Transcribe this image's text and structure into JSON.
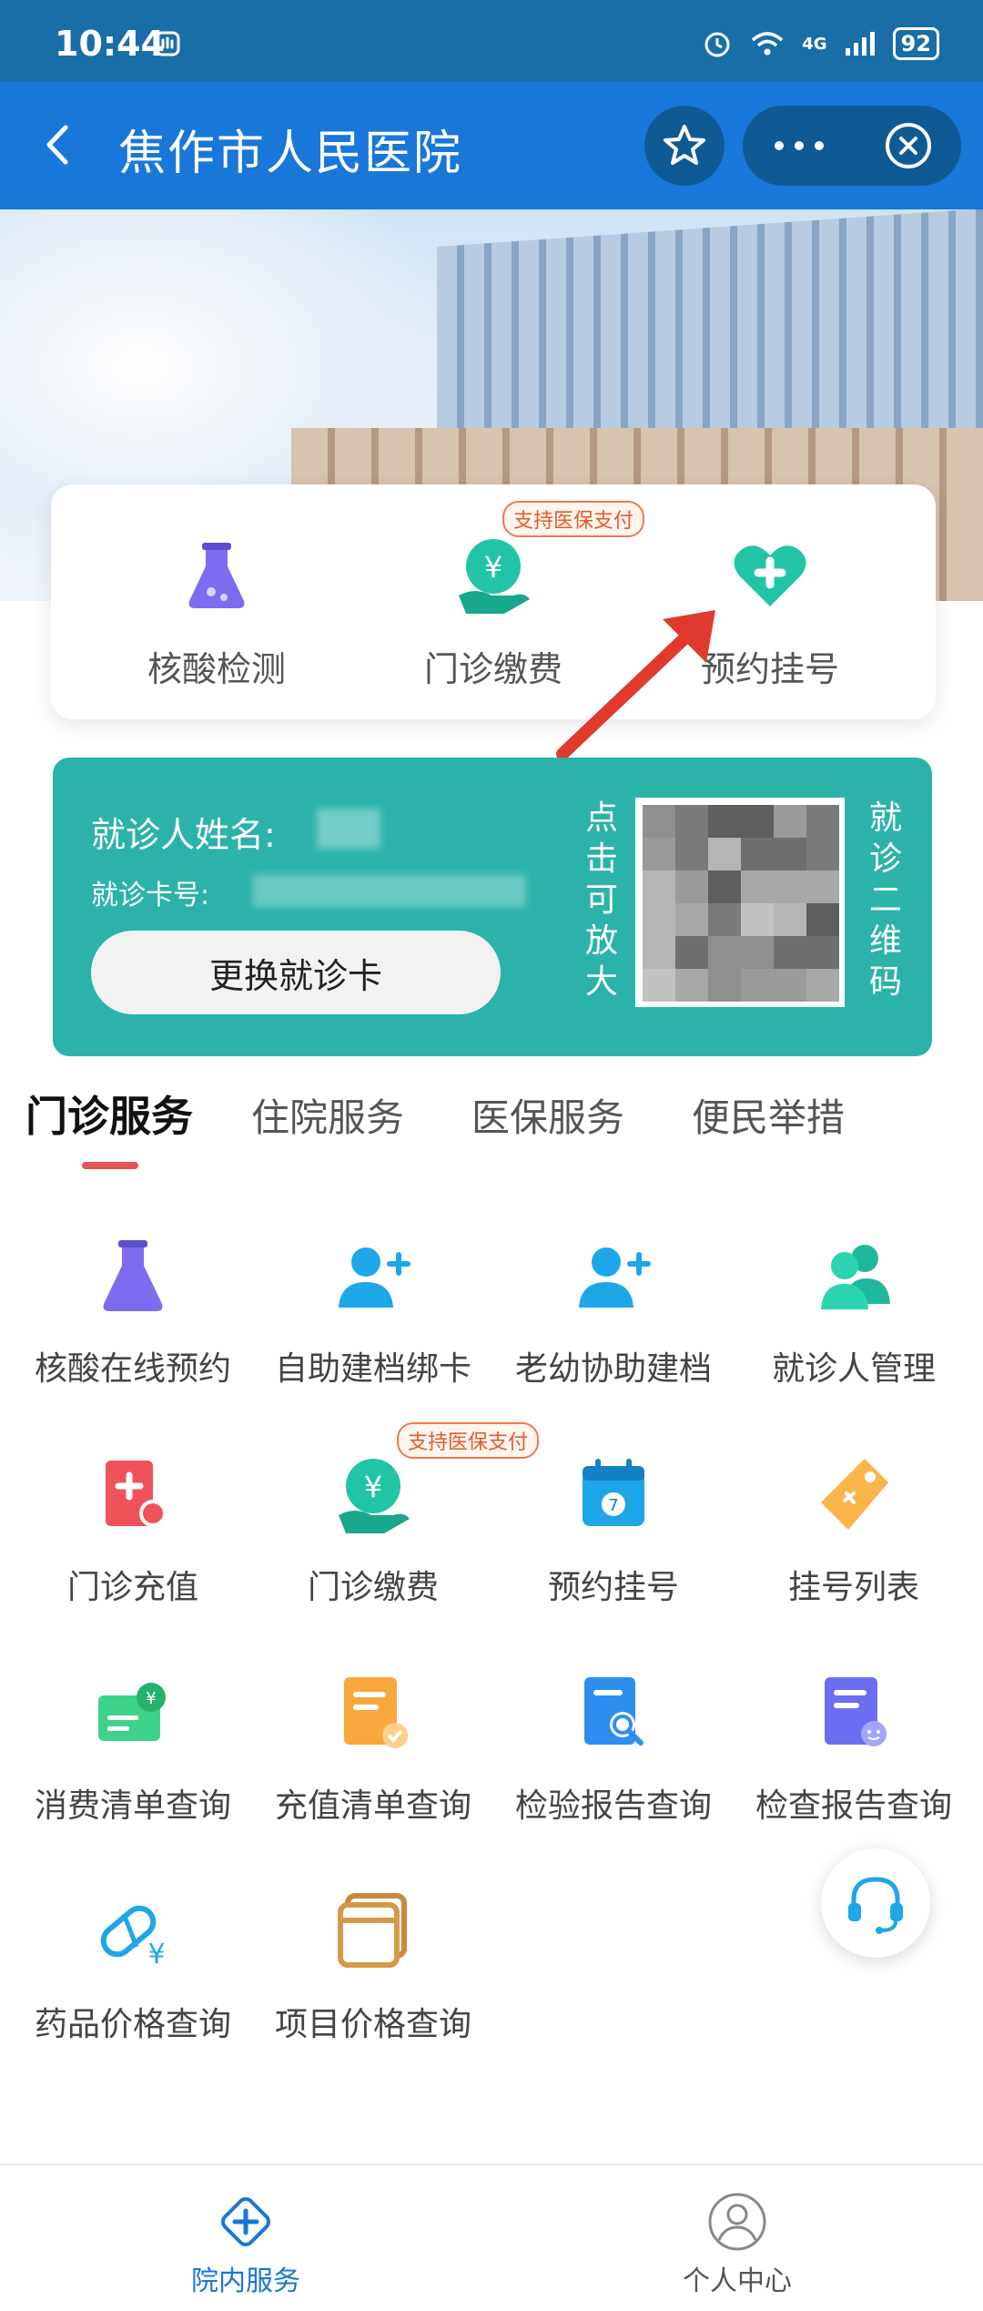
{
  "status_bar": {
    "time": "10:44",
    "network": "4G",
    "battery": "92"
  },
  "nav": {
    "title": "焦作市人民医院"
  },
  "quick_services": [
    {
      "label": "核酸检测"
    },
    {
      "label": "门诊缴费",
      "badge": "支持医保支付"
    },
    {
      "label": "预约挂号"
    }
  ],
  "patient_card": {
    "name_label": "就诊人姓名:",
    "card_label": "就诊卡号:",
    "change_button": "更换就诊卡",
    "zoom_hint": [
      "点",
      "击",
      "可",
      "放",
      "大"
    ],
    "qr_label": [
      "就",
      "诊",
      "二",
      "维",
      "码"
    ]
  },
  "tabs": [
    {
      "label": "门诊服务",
      "active": true
    },
    {
      "label": "住院服务"
    },
    {
      "label": "医保服务"
    },
    {
      "label": "便民举措"
    }
  ],
  "services": [
    {
      "label": "核酸在线预约",
      "icon": "flask-icon"
    },
    {
      "label": "自助建档绑卡",
      "icon": "add-user-icon"
    },
    {
      "label": "老幼协助建档",
      "icon": "add-user-icon"
    },
    {
      "label": "就诊人管理",
      "icon": "users-icon"
    },
    {
      "label": "门诊充值",
      "icon": "recharge-icon"
    },
    {
      "label": "门诊缴费",
      "icon": "payment-icon",
      "badge": "支持医保支付"
    },
    {
      "label": "预约挂号",
      "icon": "calendar-icon"
    },
    {
      "label": "挂号列表",
      "icon": "tag-icon"
    },
    {
      "label": "消费清单查询",
      "icon": "bill-icon"
    },
    {
      "label": "充值清单查询",
      "icon": "receipt-icon"
    },
    {
      "label": "检验报告查询",
      "icon": "lab-report-icon"
    },
    {
      "label": "检查报告查询",
      "icon": "exam-report-icon"
    },
    {
      "label": "药品价格查询",
      "icon": "pill-price-icon"
    },
    {
      "label": "项目价格查询",
      "icon": "item-price-icon"
    }
  ],
  "bottom_nav": [
    {
      "label": "院内服务",
      "active": true
    },
    {
      "label": "个人中心"
    }
  ],
  "colors": {
    "nav": "#1877d8",
    "teal": "#2bb3a9",
    "active_tab_line": "#e55454",
    "badge": "#e25b2a"
  }
}
